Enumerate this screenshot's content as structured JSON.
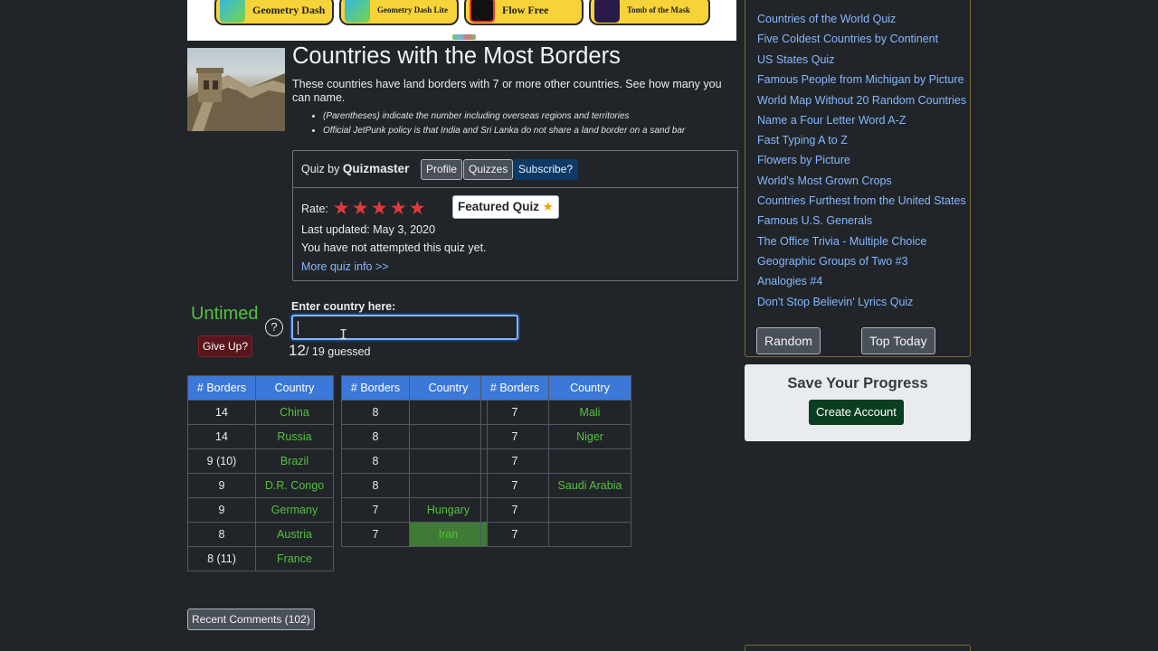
{
  "ads": {
    "items": [
      {
        "label": "Geometry Dash"
      },
      {
        "label": "Geometry Dash Lite"
      },
      {
        "label": "Flow Free"
      },
      {
        "label": "Tomb of the Mask"
      }
    ]
  },
  "quiz": {
    "title": "Countries with the Most Borders",
    "description": "These countries have land borders with 7 or more other countries. See how many you can name.",
    "notes": [
      "(Parentheses) indicate the number including overseas regions and territories",
      "Official JetPunk policy is that India and Sri Lanka do not share a land border on a sand bar"
    ]
  },
  "info": {
    "quiz_by": "Quiz by",
    "author": "Quizmaster",
    "profile_label": "Profile",
    "quizzes_label": "Quizzes",
    "subscribe_label": "Subscribe?",
    "rate_label": "Rate:",
    "stars": [
      "★",
      "★",
      "★",
      "★",
      "★"
    ],
    "featured_label": "Featured Quiz",
    "featured_star": "★",
    "updated": "Last updated: May 3, 2020",
    "attempted": "You have not attempted this quiz yet.",
    "more_info": "More quiz info >>"
  },
  "play": {
    "timer": "Untimed",
    "give_up": "Give Up?",
    "help": "?",
    "entry_label": "Enter country here:",
    "entry_value": "",
    "guessed_count": "12",
    "guessed_suffix": "/ 19 guessed"
  },
  "tables": {
    "headers": {
      "borders": "# Borders",
      "country": "Country"
    },
    "t1": [
      {
        "b": "14",
        "c": "China"
      },
      {
        "b": "14",
        "c": "Russia"
      },
      {
        "b": "9 (10)",
        "c": "Brazil"
      },
      {
        "b": "9",
        "c": "D.R. Congo"
      },
      {
        "b": "9",
        "c": "Germany"
      },
      {
        "b": "8",
        "c": "Austria"
      },
      {
        "b": "8 (11)",
        "c": "France"
      }
    ],
    "t2": [
      {
        "b": "8",
        "c": ""
      },
      {
        "b": "8",
        "c": ""
      },
      {
        "b": "8",
        "c": ""
      },
      {
        "b": "8",
        "c": ""
      },
      {
        "b": "7",
        "c": "Hungary"
      },
      {
        "b": "7",
        "c": "Iran"
      }
    ],
    "t3": [
      {
        "b": "7",
        "c": "Mali"
      },
      {
        "b": "7",
        "c": "Niger"
      },
      {
        "b": "7",
        "c": ""
      },
      {
        "b": "7",
        "c": "Saudi Arabia"
      },
      {
        "b": "7",
        "c": ""
      },
      {
        "b": "7",
        "c": ""
      }
    ]
  },
  "comments": {
    "label": "Recent Comments (102)"
  },
  "sidebar": {
    "links": [
      "Countries of the World Quiz",
      "Five Coldest Countries by Continent",
      "US States Quiz",
      "Famous People from Michigan by Picture",
      "World Map Without 20 Random Countries",
      "Name a Four Letter Word A-Z",
      "Fast Typing A to Z",
      "Flowers by Picture",
      "World's Most Grown Crops",
      "Countries Furthest from the United States",
      "Famous U.S. Generals",
      "The Office Trivia - Multiple Choice",
      "Geographic Groups of Two #3",
      "Analogies #4",
      "Don't Stop Believin' Lyrics Quiz"
    ],
    "random_label": "Random",
    "top_today_label": "Top Today"
  },
  "save": {
    "title": "Save Your Progress",
    "create_label": "Create Account"
  }
}
